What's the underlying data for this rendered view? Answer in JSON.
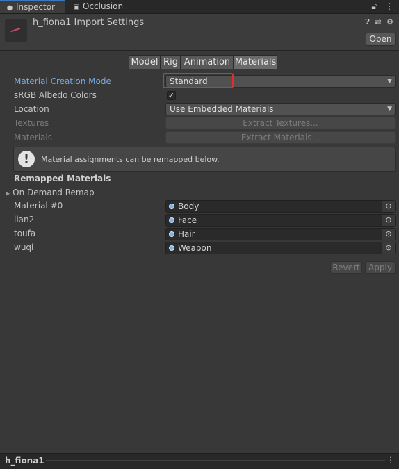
{
  "tabs": [
    {
      "label": "Inspector",
      "icon": "info-icon",
      "active": true
    },
    {
      "label": "Occlusion",
      "icon": "occlusion-icon",
      "active": false
    }
  ],
  "header": {
    "title": "h_fiona1 Import Settings",
    "open_label": "Open"
  },
  "segments": [
    "Model",
    "Rig",
    "Animation",
    "Materials"
  ],
  "selected_segment": "Materials",
  "settings": {
    "creation_mode_label": "Material Creation Mode",
    "creation_mode_value": "Standard",
    "srgb_label": "sRGB Albedo Colors",
    "srgb_checked": true,
    "location_label": "Location",
    "location_value": "Use Embedded Materials",
    "textures_label": "Textures",
    "extract_textures_label": "Extract Textures...",
    "materials_label": "Materials",
    "extract_materials_label": "Extract Materials..."
  },
  "help": {
    "message": "Material assignments can be remapped below."
  },
  "remapped": {
    "heading": "Remapped Materials",
    "foldout_label": "On Demand Remap",
    "rows": [
      {
        "label": "Material #0",
        "value": "Body"
      },
      {
        "label": "lian2",
        "value": "Face"
      },
      {
        "label": "toufa",
        "value": "Hair"
      },
      {
        "label": "wuqi",
        "value": "Weapon"
      }
    ]
  },
  "actions": {
    "revert_label": "Revert",
    "apply_label": "Apply"
  },
  "footer": {
    "asset_name": "h_fiona1"
  },
  "colors": {
    "highlight_label": "#7ba8e0",
    "annotation_box": "#e52b2b",
    "active_tab_accent": "#3a79bb"
  }
}
